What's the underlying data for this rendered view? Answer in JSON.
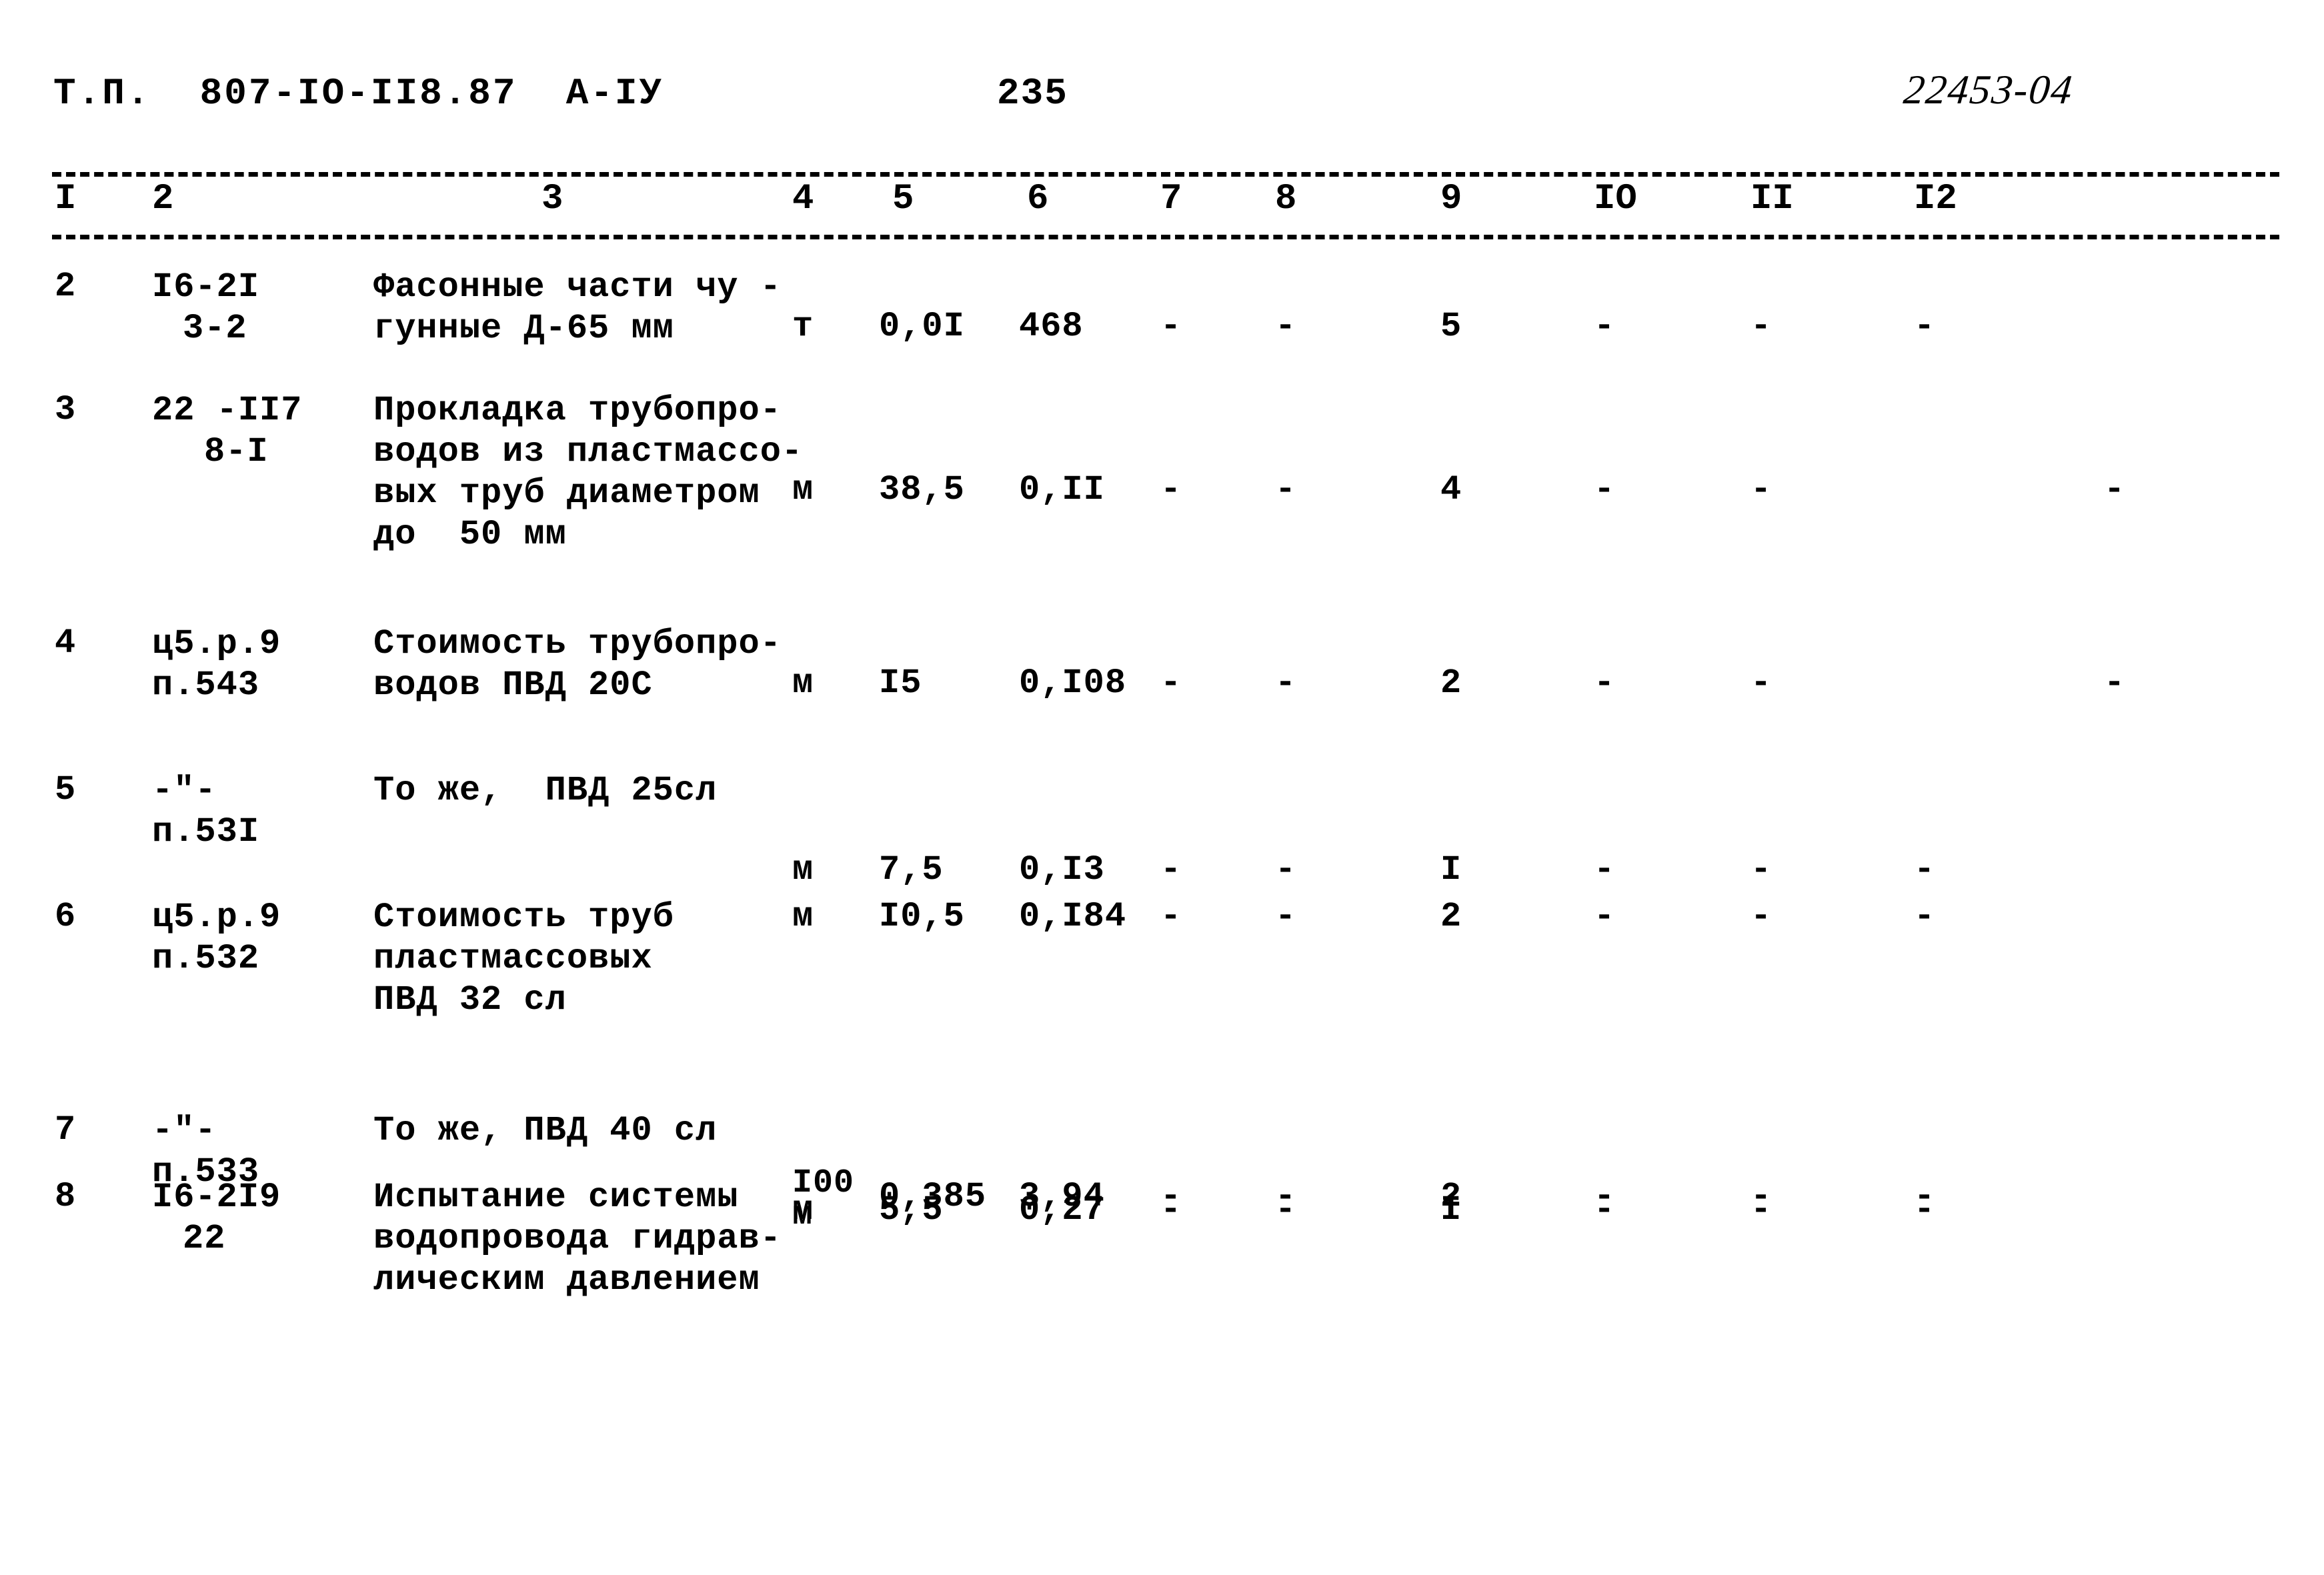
{
  "header": {
    "left": "Т.П.  807-IO-II8.87  А-IУ",
    "page_number": "235",
    "doc_code": "22453-04"
  },
  "table": {
    "column_numbers": [
      "I",
      "2",
      "3",
      "4",
      "5",
      "6",
      "7",
      "8",
      "9",
      "IO",
      "II",
      "I2"
    ],
    "rows": [
      {
        "num": "2",
        "code_line1": "I6-2I",
        "code_line2": "3-2",
        "name_lines": [
          "Фасонные части чу -",
          "гунные Д-65 мм"
        ],
        "unit": "т",
        "c5": "0,0I",
        "c6": "468",
        "c7": "-",
        "c8": "-",
        "c9": "5",
        "c10": "-",
        "c11": "-",
        "c12": "-",
        "c12_shifted": false
      },
      {
        "num": "3",
        "code_line1": "22 -II7",
        "code_line2": "8-I",
        "name_lines": [
          "Прокладка трубопро-",
          "водов из пластмассо-",
          "вых труб диаметром",
          "до  50 мм"
        ],
        "unit": "м",
        "c5": "38,5",
        "c6": "0,II",
        "c7": "-",
        "c8": "-",
        "c9": "4",
        "c10": "-",
        "c11": "-",
        "c12": "-",
        "c12_shifted": true
      },
      {
        "num": "4",
        "code_line1": "ц5.р.9",
        "code_line2": "п.543",
        "name_lines": [
          "Стоимость трубопро-",
          "водов ПВД 20С"
        ],
        "unit": "м",
        "c5": "I5",
        "c6": "0,I08",
        "c7": "-",
        "c8": "-",
        "c9": "2",
        "c10": "-",
        "c11": "-",
        "c12": "-",
        "c12_shifted": true
      },
      {
        "num": "5",
        "code_line1": "-\"-",
        "code_line2": "п.53I",
        "name_lines": [
          "То же,  ПВД 25сл"
        ],
        "unit": "м",
        "c5": "7,5",
        "c6": "0,I3",
        "c7": "-",
        "c8": "-",
        "c9": "I",
        "c10": "-",
        "c11": "-",
        "c12": "-",
        "c12_shifted": false
      },
      {
        "num": "6",
        "code_line1": "ц5.р.9",
        "code_line2": "п.532",
        "name_lines": [
          "Стоимость труб",
          "пластмассовых",
          "ПВД 32 сл"
        ],
        "unit": "м",
        "c5": "I0,5",
        "c6": "0,I84",
        "c7": "-",
        "c8": "-",
        "c9": "2",
        "c10": "-",
        "c11": "-",
        "c12": "-",
        "c12_shifted": false
      },
      {
        "num": "7",
        "code_line1": "-\"-",
        "code_line2": "п.533",
        "name_lines": [
          "То же, ПВД 40 сл"
        ],
        "unit": "м",
        "c5": "5,5",
        "c6": "0,27",
        "c7": "-",
        "c8": "-",
        "c9": "I",
        "c10": "-",
        "c11": "-",
        "c12": "-",
        "c12_shifted": false
      },
      {
        "num": "8",
        "code_line1": "I6-2I9",
        "code_line2": "22",
        "name_lines": [
          "Испытание системы",
          "водопровода гидрав-",
          "лическим давлением"
        ],
        "unit_line1": "I00",
        "unit_line2": "м",
        "unit": "",
        "c5": "0,385",
        "c6": "3,94",
        "c7": "-",
        "c8": "-",
        "c9": "2",
        "c10": "-",
        "c11": "-",
        "c12": "-",
        "c12_shifted": false
      }
    ]
  }
}
